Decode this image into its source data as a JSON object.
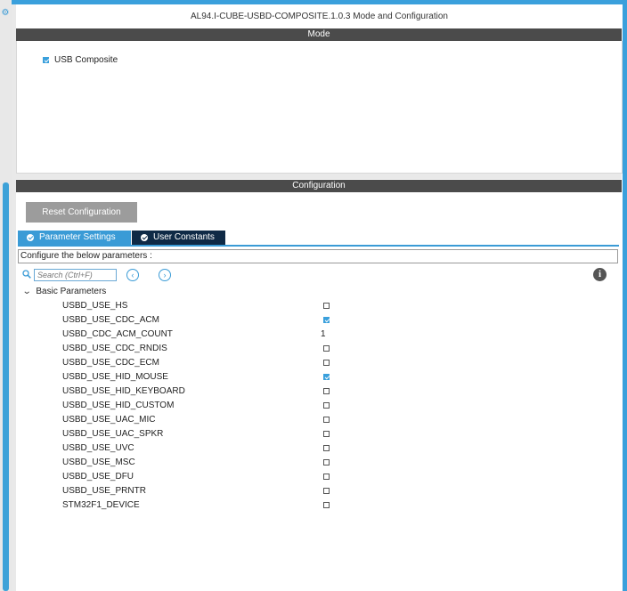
{
  "window": {
    "title": "AL94.I-CUBE-USBD-COMPOSITE.1.0.3 Mode and Configuration"
  },
  "mode": {
    "header": "Mode",
    "usb_composite": {
      "label": "USB Composite",
      "checked": true
    }
  },
  "configuration": {
    "header": "Configuration",
    "reset_label": "Reset Configuration",
    "tabs": [
      {
        "label": "Parameter Settings",
        "active": true
      },
      {
        "label": "User Constants",
        "active": false
      }
    ],
    "description": "Configure the below parameters :",
    "search": {
      "placeholder": "Search (Ctrl+F)"
    },
    "group": {
      "label": "Basic Parameters",
      "params": [
        {
          "name": "USBD_USE_HS",
          "checked": false
        },
        {
          "name": "USBD_USE_CDC_ACM",
          "checked": true
        },
        {
          "name": "USBD_CDC_ACM_COUNT",
          "value": "1"
        },
        {
          "name": "USBD_USE_CDC_RNDIS",
          "checked": false
        },
        {
          "name": "USBD_USE_CDC_ECM",
          "checked": false
        },
        {
          "name": "USBD_USE_HID_MOUSE",
          "checked": true
        },
        {
          "name": "USBD_USE_HID_KEYBOARD",
          "checked": false
        },
        {
          "name": "USBD_USE_HID_CUSTOM",
          "checked": false
        },
        {
          "name": "USBD_USE_UAC_MIC",
          "checked": false
        },
        {
          "name": "USBD_USE_UAC_SPKR",
          "checked": false
        },
        {
          "name": "USBD_USE_UVC",
          "checked": false
        },
        {
          "name": "USBD_USE_MSC",
          "checked": false
        },
        {
          "name": "USBD_USE_DFU",
          "checked": false
        },
        {
          "name": "USBD_USE_PRNTR",
          "checked": false
        },
        {
          "name": "STM32F1_DEVICE",
          "checked": false
        }
      ]
    }
  },
  "icons": {
    "gear": "gear-icon",
    "checkbox": "checkbox-icon",
    "search": "search-icon",
    "prev": "chevron-left-icon",
    "next": "chevron-right-icon",
    "info": "info-icon",
    "expand": "chevron-down-icon"
  },
  "colors": {
    "accent": "#3aa0dc",
    "header_bar": "#4b4b4b",
    "tab_dark": "#0f2a46",
    "button": "#9c9c9c"
  }
}
